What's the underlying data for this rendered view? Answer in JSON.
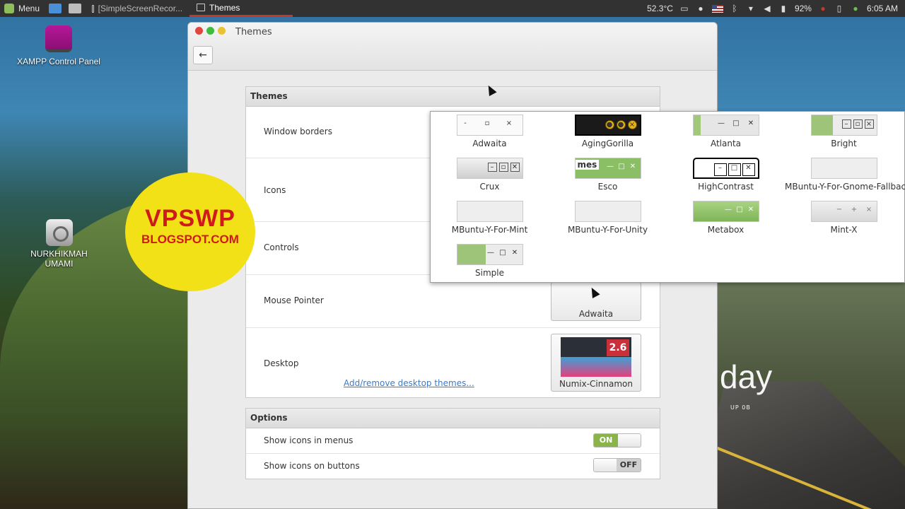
{
  "panel": {
    "menu_label": "Menu",
    "tasks": [
      {
        "label": "[SimpleScreenRecor..."
      },
      {
        "label": "Themes"
      }
    ],
    "temperature": "52.3°C",
    "battery": "92%",
    "clock": "6:05 AM"
  },
  "desktop": {
    "icons": [
      {
        "label": "XAMPP Control Panel"
      },
      {
        "label": "NURKHIKMAH UMAMI"
      }
    ],
    "wallpaper_text": "day",
    "wallpaper_sub": "UP 0B"
  },
  "logo": {
    "line1": "VPSWP",
    "line2": "BLOGSPOT.COM"
  },
  "window": {
    "title": "Themes",
    "themes_section": {
      "heading": "Themes",
      "rows": [
        {
          "label": "Window borders"
        },
        {
          "label": "Icons"
        },
        {
          "label": "Controls"
        },
        {
          "label": "Mouse Pointer",
          "value": "Adwaita"
        },
        {
          "label": "Desktop",
          "value": "Numix-Cinnamon",
          "link": "Add/remove desktop themes...",
          "thumb_version": "2.6"
        }
      ]
    },
    "options_section": {
      "heading": "Options",
      "rows": [
        {
          "label": "Show icons in menus",
          "toggle": "ON",
          "state": true
        },
        {
          "label": "Show icons on buttons",
          "toggle": "OFF",
          "state": false
        }
      ]
    }
  },
  "popup": {
    "themes": [
      {
        "name": "Adwaita"
      },
      {
        "name": "AgingGorilla"
      },
      {
        "name": "Atlanta"
      },
      {
        "name": "Bright"
      },
      {
        "name": "Crux"
      },
      {
        "name": "Esco"
      },
      {
        "name": "HighContrast"
      },
      {
        "name": "MBuntu-Y-For-Gnome-Fallback"
      },
      {
        "name": "MBuntu-Y-For-Mint"
      },
      {
        "name": "MBuntu-Y-For-Unity"
      },
      {
        "name": "Metabox"
      },
      {
        "name": "Mint-X"
      },
      {
        "name": "Simple"
      }
    ],
    "esco_preview_text": "mes"
  },
  "colors": {
    "accent_green": "#8ab34a",
    "link": "#3a7ad1",
    "logo_red": "#d0191b",
    "logo_yellow": "#f2e116"
  }
}
